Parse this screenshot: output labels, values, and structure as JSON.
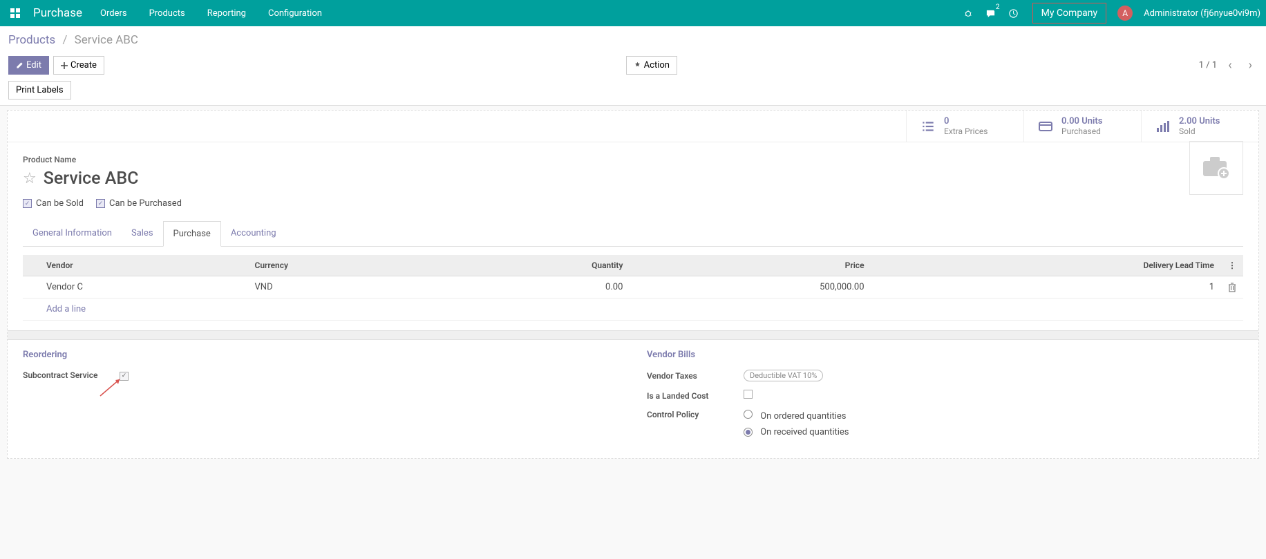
{
  "nav": {
    "brand": "Purchase",
    "items": [
      "Orders",
      "Products",
      "Reporting",
      "Configuration"
    ],
    "chat_badge": "2",
    "company": "My Company",
    "user_initial": "A",
    "user_name": "Administrator (fj6nyue0vi9m)"
  },
  "breadcrumb": {
    "parent": "Products",
    "current": "Service ABC"
  },
  "buttons": {
    "edit": "Edit",
    "create": "Create",
    "action": "Action",
    "print_labels": "Print Labels"
  },
  "pager": {
    "text": "1 / 1"
  },
  "stats": [
    {
      "value": "0",
      "label": "Extra Prices",
      "icon": "list-icon"
    },
    {
      "value": "0.00 Units",
      "label": "Purchased",
      "icon": "card-icon"
    },
    {
      "value": "2.00 Units",
      "label": "Sold",
      "icon": "bars-icon"
    }
  ],
  "product": {
    "name_label": "Product Name",
    "name": "Service ABC",
    "can_be_sold": "Can be Sold",
    "can_be_purchased": "Can be Purchased"
  },
  "tabs": [
    "General Information",
    "Sales",
    "Purchase",
    "Accounting"
  ],
  "vendor_table": {
    "headers": {
      "vendor": "Vendor",
      "currency": "Currency",
      "quantity": "Quantity",
      "price": "Price",
      "lead": "Delivery Lead Time"
    },
    "rows": [
      {
        "vendor": "Vendor C",
        "currency": "VND",
        "quantity": "0.00",
        "price": "500,000.00",
        "lead": "1"
      }
    ],
    "add_line": "Add a line"
  },
  "reordering": {
    "title": "Reordering",
    "subcontract_label": "Subcontract Service"
  },
  "vendor_bills": {
    "title": "Vendor Bills",
    "taxes_label": "Vendor Taxes",
    "taxes_value": "Deductible VAT 10%",
    "landed_label": "Is a Landed Cost",
    "control_label": "Control Policy",
    "control_opt1": "On ordered quantities",
    "control_opt2": "On received quantities"
  }
}
